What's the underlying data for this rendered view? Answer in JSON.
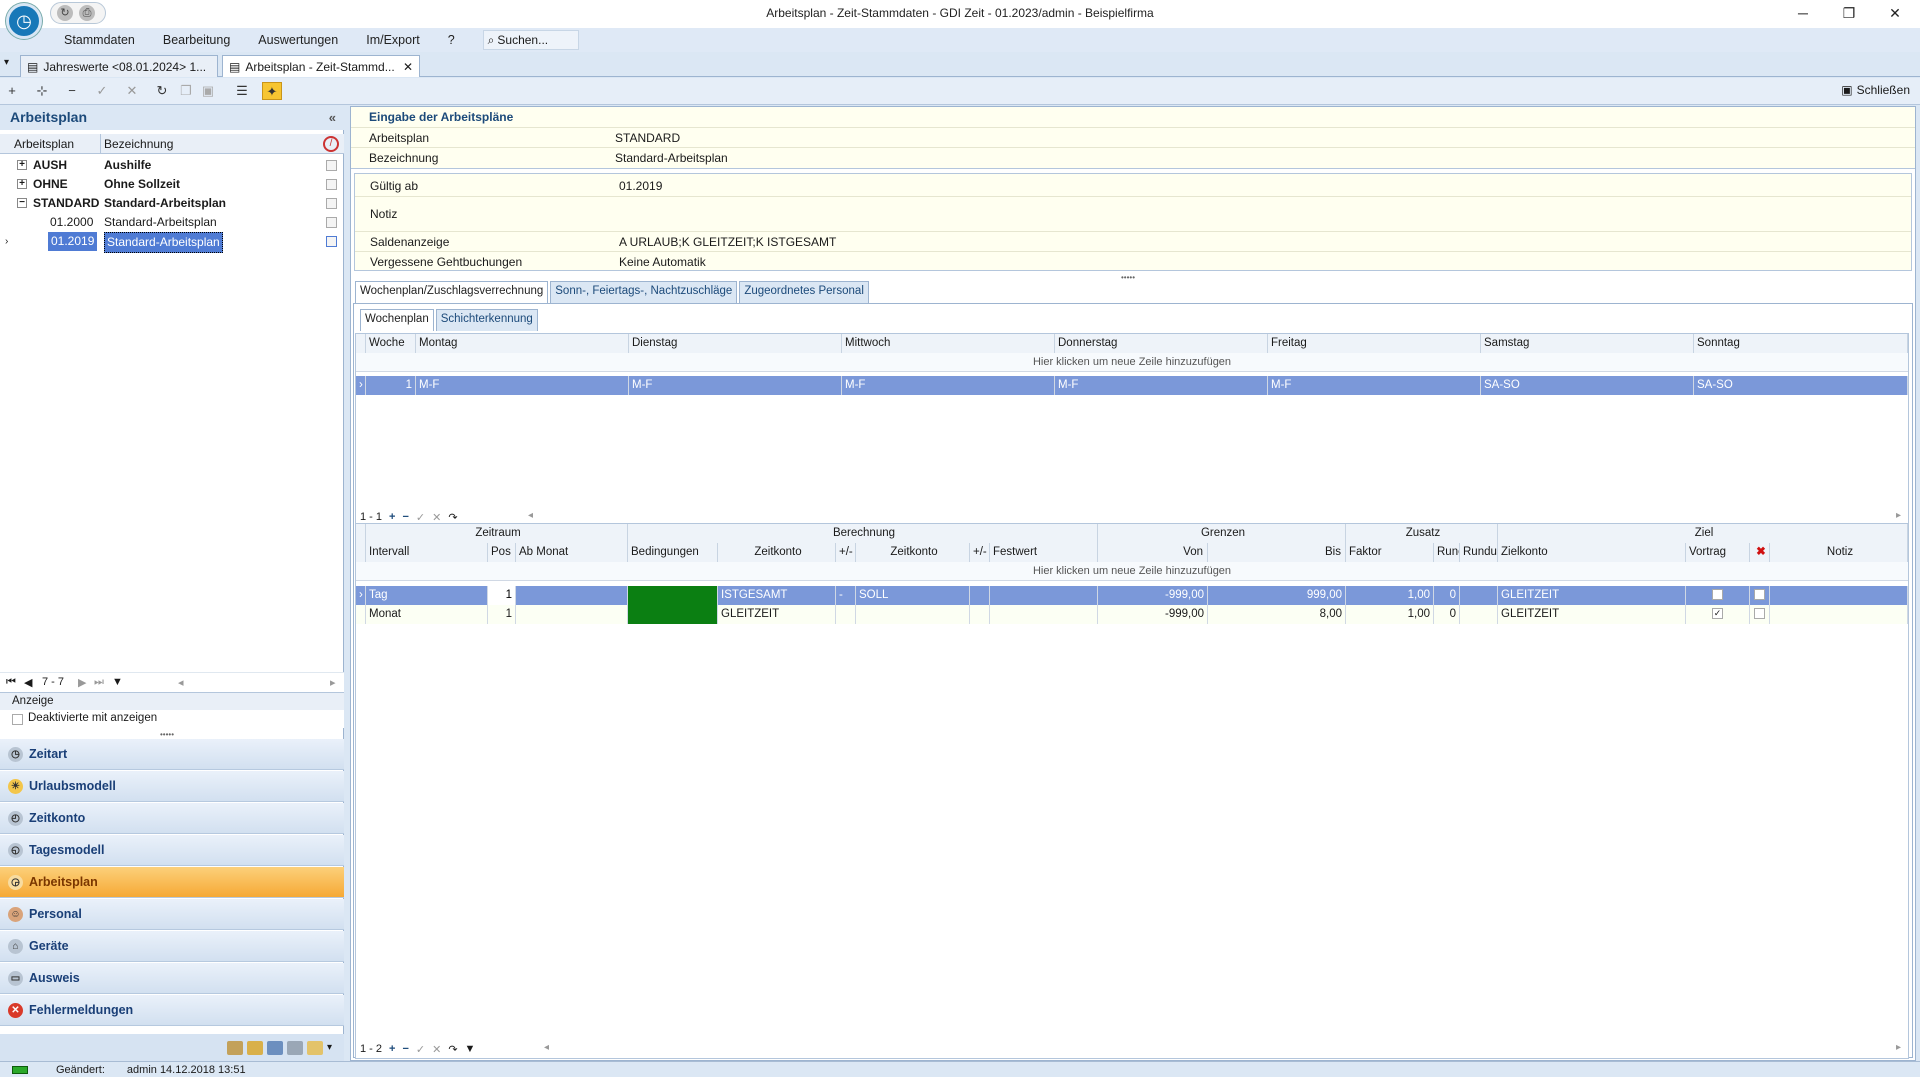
{
  "window": {
    "title": "Arbeitsplan - Zeit-Stammdaten  -  GDI Zeit - 01.2023/admin - Beispielfirma"
  },
  "menu": {
    "items": [
      "Stammdaten",
      "Bearbeitung",
      "Auswertungen",
      "Im/Export",
      "?"
    ],
    "search": "Suchen..."
  },
  "tabs": [
    {
      "label": "Jahreswerte <08.01.2024> 1..."
    },
    {
      "label": "Arbeitsplan - Zeit-Stammd..."
    }
  ],
  "toolbar": {
    "close_label": "Schließen"
  },
  "left": {
    "title": "Arbeitsplan",
    "col_code": "Arbeitsplan",
    "col_name": "Bezeichnung",
    "rows": [
      {
        "code": "AUSH",
        "name": "Aushilfe",
        "exp": "+"
      },
      {
        "code": "OHNE",
        "name": "Ohne Sollzeit",
        "exp": "+"
      },
      {
        "code": "STANDARD",
        "name": "Standard-Arbeitsplan",
        "exp": "−"
      },
      {
        "code": "01.2000",
        "name": "Standard-Arbeitsplan"
      },
      {
        "code": "01.2019",
        "name": "Standard-Arbeitsplan"
      }
    ],
    "pager": "7 - 7",
    "anzeige_label": "Anzeige",
    "deaktivierte_label": "Deaktivierte mit anzeigen",
    "nav": [
      "Zeitart",
      "Urlaubsmodell",
      "Zeitkonto",
      "Tagesmodell",
      "Arbeitsplan",
      "Personal",
      "Geräte",
      "Ausweis",
      "Fehlermeldungen"
    ]
  },
  "form": {
    "section_title": "Eingabe der Arbeitspläne",
    "arbeitsplan_label": "Arbeitsplan",
    "arbeitsplan_value": "STANDARD",
    "bezeichnung_label": "Bezeichnung",
    "bezeichnung_value": "Standard-Arbeitsplan",
    "gueltig_label": "Gültig ab",
    "gueltig_value": "01.2019",
    "notiz_label": "Notiz",
    "saldo_label": "Saldenanzeige",
    "saldo_value": "A URLAUB;K GLEITZEIT;K ISTGESAMT",
    "geht_label": "Vergessene Gehtbuchungen",
    "geht_value": "Keine Automatik"
  },
  "detail_tabs": [
    "Wochenplan/Zuschlagsverrechnung",
    "Sonn-, Feiertags-, Nachtzuschläge",
    "Zugeordnetes Personal"
  ],
  "sub_tabs": [
    "Wochenplan",
    "Schichterkennung"
  ],
  "week": {
    "headers": [
      "Woche",
      "Montag",
      "Dienstag",
      "Mittwoch",
      "Donnerstag",
      "Freitag",
      "Samstag",
      "Sonntag"
    ],
    "add_row": "Hier klicken um neue Zeile hinzuzufügen",
    "rows": [
      [
        "1",
        "M-F",
        "M-F",
        "M-F",
        "M-F",
        "M-F",
        "SA-SO",
        "SA-SO"
      ]
    ],
    "pager": "1 - 1"
  },
  "calc": {
    "groups": [
      "Zeitraum",
      "Berechnung",
      "Grenzen",
      "Zusatz",
      "Ziel"
    ],
    "headers": [
      "Intervall",
      "Pos",
      "Ab Monat",
      "Bedingungen",
      "Zeitkonto",
      "+/-",
      "Zeitkonto",
      "+/-",
      "Festwert",
      "Von",
      "Bis",
      "Faktor",
      "Runc",
      "Rundur",
      "Zielkonto",
      "Vortrag",
      "",
      "Notiz"
    ],
    "add_row": "Hier klicken um neue Zeile hinzuzufügen",
    "rows": [
      [
        "Tag",
        "1",
        "",
        "",
        "ISTGESAMT",
        "-",
        "SOLL",
        "",
        "",
        "-999,00",
        "999,00",
        "1,00",
        "0",
        "",
        "GLEITZEIT"
      ],
      [
        "Monat",
        "1",
        "",
        "",
        "GLEITZEIT",
        "",
        "",
        "",
        "",
        "-999,00",
        "8,00",
        "1,00",
        "0",
        "",
        "GLEITZEIT"
      ]
    ],
    "pager": "1 - 2"
  },
  "status": {
    "label": "Geändert:",
    "value": "admin 14.12.2018 13:51"
  }
}
